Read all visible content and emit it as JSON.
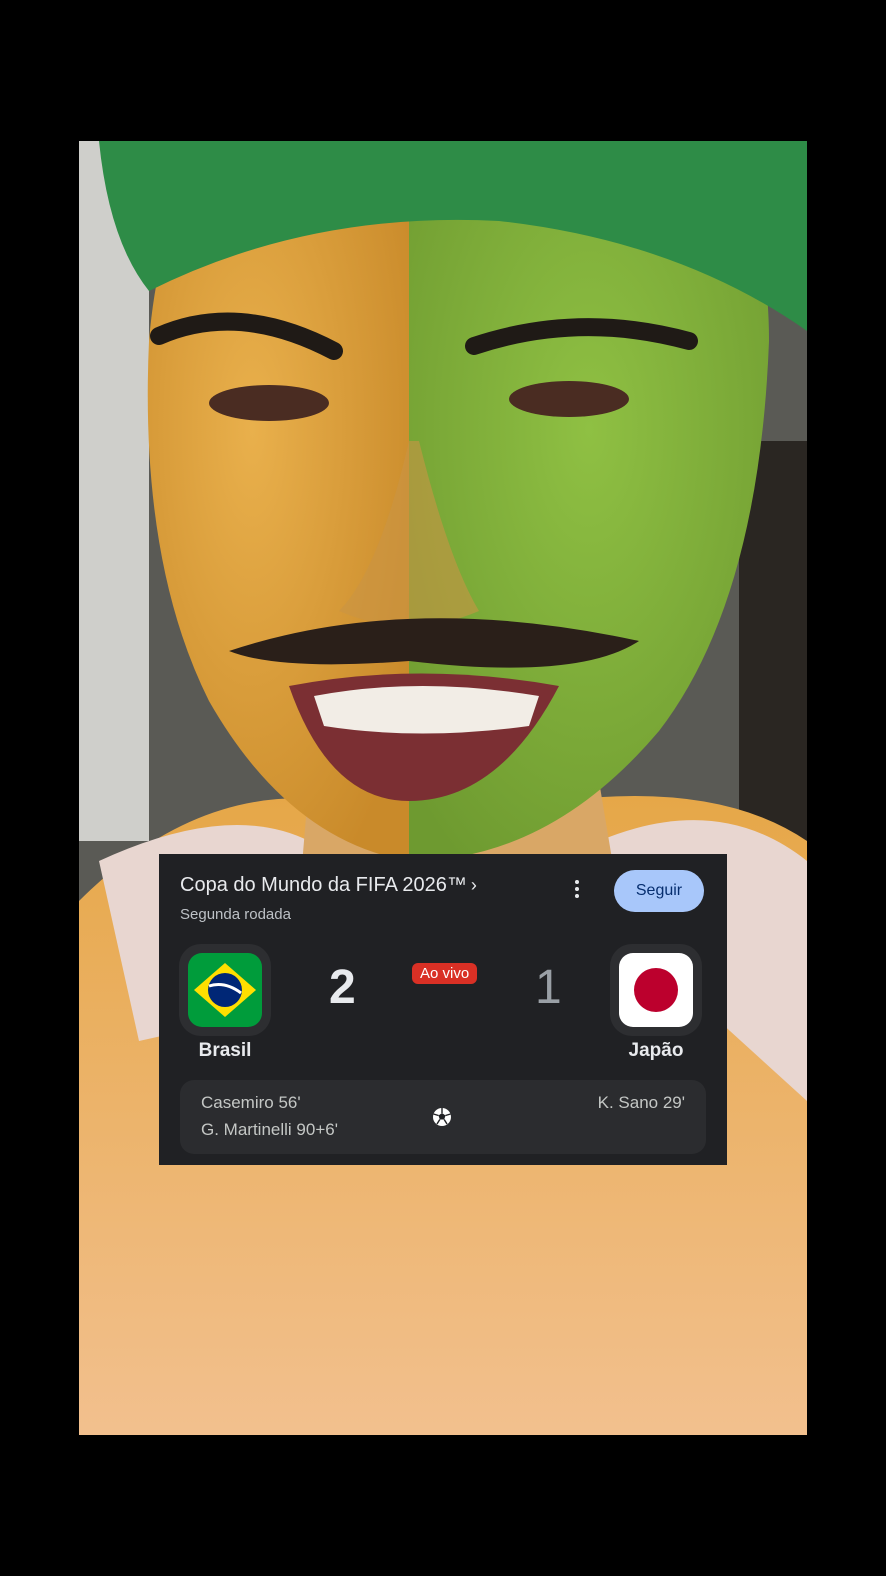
{
  "match": {
    "competition": "Copa do Mundo da FIFA 2026™",
    "competition_chevron": "›",
    "round": "Segunda rodada",
    "follow_label": "Seguir",
    "status": "Ao vivo",
    "home": {
      "name": "Brasil",
      "score": "2",
      "flag": "brazil-flag-icon",
      "scorers": [
        "Casemiro 56'",
        "G. Martinelli 90+6'"
      ]
    },
    "away": {
      "name": "Japão",
      "score": "1",
      "flag": "japan-flag-icon",
      "scorers": [
        "K. Sano 29'"
      ]
    },
    "goal_icon": "soccer-ball-icon",
    "more_icon": "more-vert-icon"
  },
  "colors": {
    "card_bg": "#202124",
    "follow_bg": "#a8c7fa",
    "live_red": "#d93025",
    "brazil_green": "#009c3b",
    "brazil_yellow": "#ffdf00",
    "brazil_blue": "#002776",
    "japan_red": "#bc002d"
  }
}
